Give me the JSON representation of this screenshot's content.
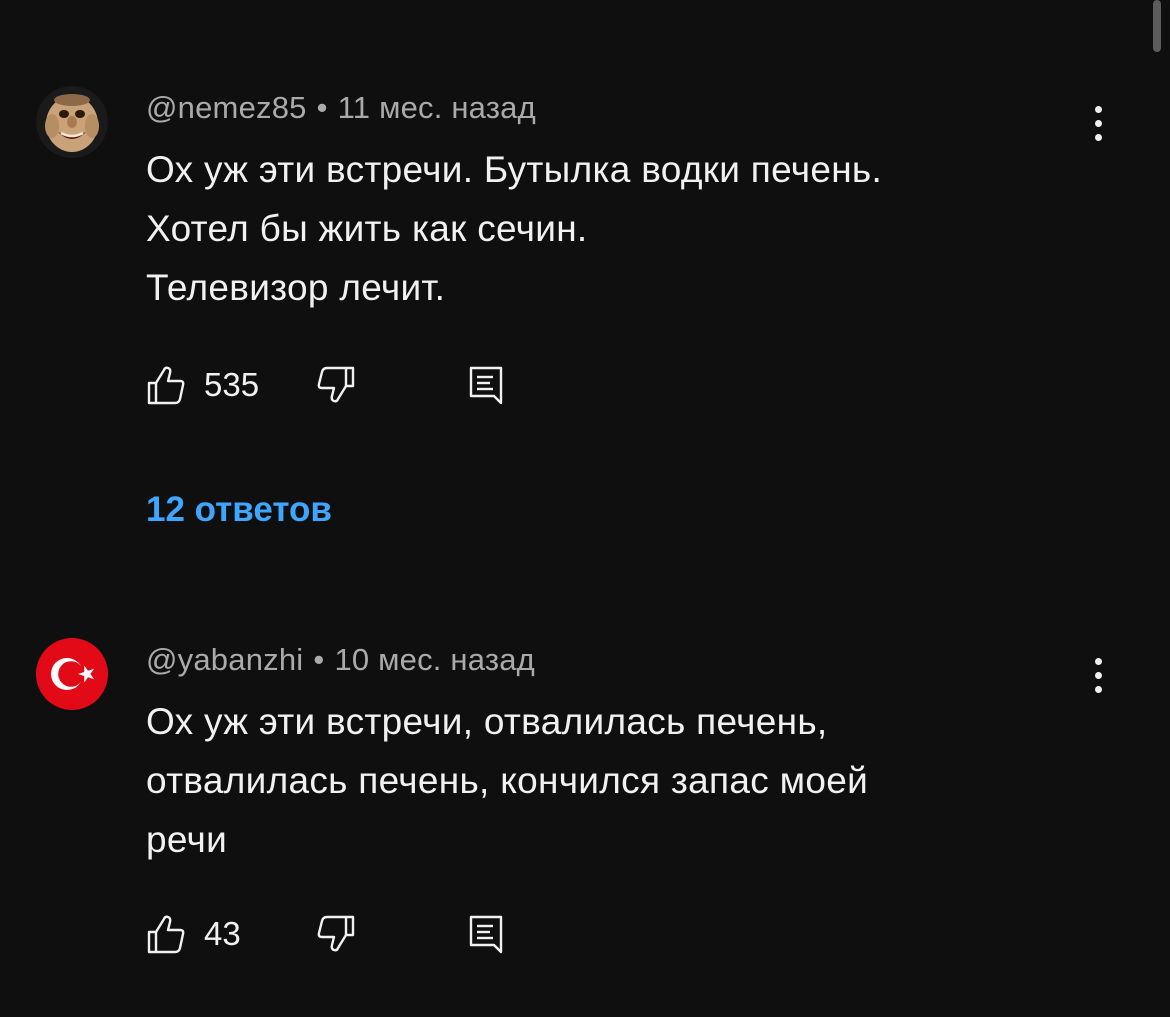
{
  "comments": [
    {
      "author": "@nemez85",
      "separator": "•",
      "time": "11 мес. назад",
      "lines": [
        "Ох уж эти встречи. Бутылка водки печень.",
        "Хотел бы жить как сечин.",
        "Телевизор лечит."
      ],
      "likes": "535",
      "replies_label": "12 ответов"
    },
    {
      "author": "@yabanzhi",
      "separator": "•",
      "time": "10 мес. назад",
      "lines": [
        "Ох уж эти встречи, отвалилась печень,",
        "отвалилась печень, кончился запас моей",
        "речи"
      ],
      "likes": "43"
    }
  ],
  "colors": {
    "background": "#0f0f0f",
    "text": "#f1f1f1",
    "meta": "#aaaaaa",
    "link": "#3ea6ff",
    "flag_red": "#e30a17"
  },
  "icons": {
    "like": "thumb-up-icon",
    "dislike": "thumb-down-icon",
    "reply": "comment-reply-icon",
    "menu": "more-vertical-icon"
  }
}
